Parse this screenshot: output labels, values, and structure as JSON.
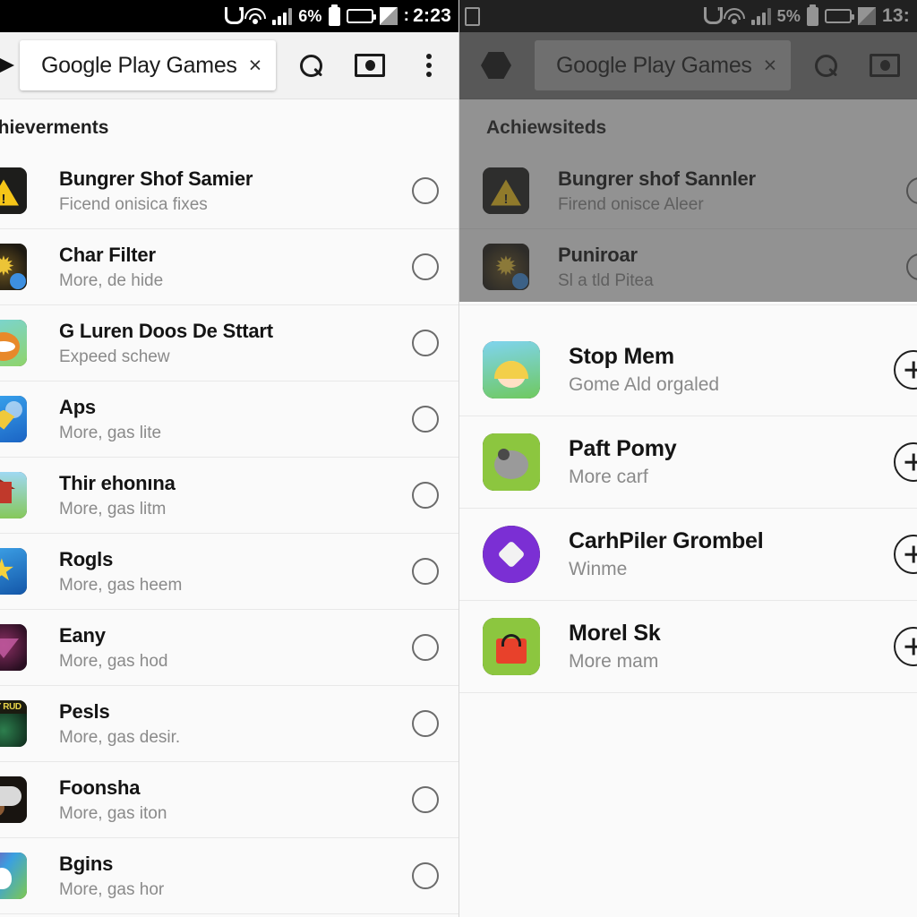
{
  "panels": {
    "left": {
      "status_bar": {
        "icons": [
          "magnet-icon",
          "wifi-icon",
          "signal-icon"
        ],
        "battery_percent": "6%",
        "clock_separator": ":",
        "clock": "2:23"
      },
      "toolbar": {
        "back_icon": "arrow-right-icon",
        "tab_title": "Google Play Games",
        "tab_close": "×",
        "search_icon": "search-icon",
        "capture_icon": "screenshot-icon",
        "overflow_icon": "more-vertical-icon"
      },
      "section_title": "chieverments",
      "rows": [
        {
          "title": "Bungrer Shof Samier",
          "subtitle": "Ficend onisica fixes",
          "art": "art-warn",
          "control": "radio"
        },
        {
          "title": "Char Filter",
          "subtitle": "More, de hide",
          "art": "art-gold",
          "control": "radio"
        },
        {
          "title": "G Luren Doos De Sttart",
          "subtitle": "Expeed schew",
          "art": "art-dog",
          "control": "radio"
        },
        {
          "title": "Aps",
          "subtitle": "More, gas lite",
          "art": "art-blue",
          "control": "radio"
        },
        {
          "title": "Thir ehonına",
          "subtitle": "More, gas litm",
          "art": "art-farm",
          "control": "radio"
        },
        {
          "title": "Rogls",
          "subtitle": "More, gas heem",
          "art": "art-star",
          "control": "radio"
        },
        {
          "title": "Eany",
          "subtitle": "More, gas hod",
          "art": "art-purple",
          "control": "radio"
        },
        {
          "title": "Pesls",
          "subtitle": "More, gas desir.",
          "art": "art-green",
          "control": "radio",
          "art_label": "LLY RUD"
        },
        {
          "title": "Foonsha",
          "subtitle": "More, gas iton",
          "art": "art-monkey",
          "control": "radio"
        },
        {
          "title": "Bgins",
          "subtitle": "More, gas hor",
          "art": "art-rainbow",
          "control": "radio"
        }
      ]
    },
    "right": {
      "status_bar": {
        "tablet_icon": "tablet-icon",
        "icons": [
          "magnet-icon",
          "wifi-icon",
          "signal-icon"
        ],
        "battery_percent": "5%",
        "clock": "13:"
      },
      "toolbar": {
        "back_icon": "hexagon-icon",
        "tab_title": "Google Play Games",
        "tab_close": "×",
        "search_icon": "search-icon",
        "capture_icon": "screenshot-icon",
        "overflow_icon": "more-vertical-icon"
      },
      "section_title": "Achiewsiteds",
      "dimmed_rows": [
        {
          "title": "Bungrer shof Sannler",
          "subtitle": "Firend onisce Aleer",
          "art": "art-warn",
          "control": "radio"
        },
        {
          "title": "Puniroar",
          "subtitle": "Sl a tld Pitea",
          "art": "art-gold",
          "control": "radio"
        }
      ],
      "rows": [
        {
          "title": "Stop Mem",
          "subtitle": "Gome Ald orgaled",
          "art": "art-girl",
          "control": "plus"
        },
        {
          "title": "Paft Pomy",
          "subtitle": "More carf",
          "art": "art-mole",
          "control": "plus"
        },
        {
          "title": "CarhPiler Grombel",
          "subtitle": "Winme",
          "art": "art-gem",
          "control": "plus"
        },
        {
          "title": "Morel Sk",
          "subtitle": "More mam",
          "art": "art-bag",
          "control": "plus"
        }
      ]
    }
  },
  "colors": {
    "status_bar_bg": "#000000",
    "toolbar_bg": "#f2f2f2",
    "toolbar_bg_dim": "#7a7a7a",
    "list_bg": "#fafafa",
    "title_text": "#141414",
    "subtitle_text": "#8a8a8a",
    "divider": "#e8e8e8"
  }
}
